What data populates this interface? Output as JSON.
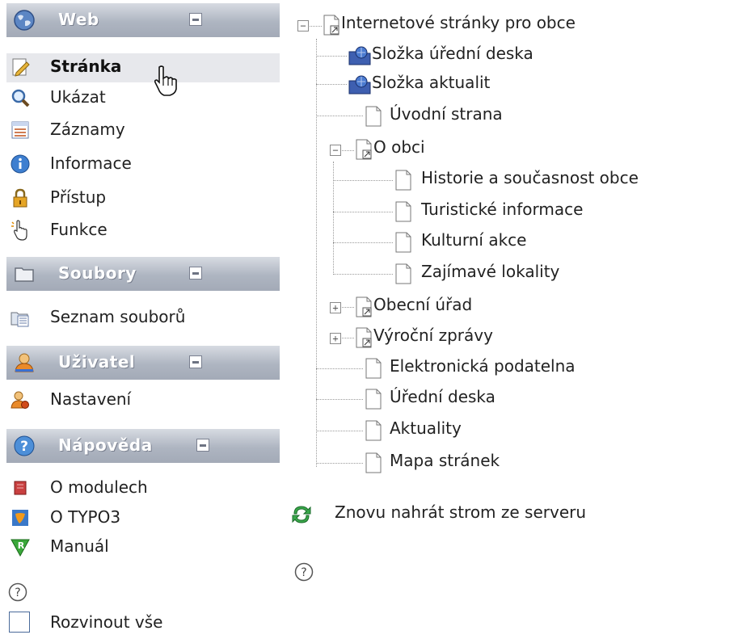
{
  "menu": {
    "groups": [
      {
        "title": "Web",
        "icon": "globe-icon",
        "items": [
          {
            "label": "Stránka",
            "icon": "page-edit-icon",
            "selected": true
          },
          {
            "label": "Ukázat",
            "icon": "magnifier-icon"
          },
          {
            "label": "Záznamy",
            "icon": "list-table-icon"
          },
          {
            "label": "Informace",
            "icon": "info-icon"
          },
          {
            "label": "Přístup",
            "icon": "padlock-icon"
          },
          {
            "label": "Funkce",
            "icon": "hand-pointer-icon"
          }
        ]
      },
      {
        "title": "Soubory",
        "icon": "folder-icon",
        "items": [
          {
            "label": "Seznam souborů",
            "icon": "file-list-icon"
          }
        ]
      },
      {
        "title": "Uživatel",
        "icon": "user-icon",
        "items": [
          {
            "label": "Nastavení",
            "icon": "user-settings-icon"
          }
        ]
      },
      {
        "title": "Nápověda",
        "icon": "help-icon",
        "items": [
          {
            "label": "O modulech",
            "icon": "module-icon"
          },
          {
            "label": "O TYPO3",
            "icon": "typo3-icon"
          },
          {
            "label": "Manuál",
            "icon": "manual-icon"
          }
        ]
      }
    ],
    "help_icon": "question-circle-icon",
    "expand_all_label": "Rozvinout vše"
  },
  "tree": {
    "nodes": [
      {
        "label": "Internetové stránky pro obce",
        "icon": "page-shortcut-icon",
        "level": 0,
        "toggle": "minus"
      },
      {
        "label": "Složka úřední deska",
        "icon": "sysfolder-icon",
        "level": 1
      },
      {
        "label": "Složka aktualit",
        "icon": "sysfolder-icon",
        "level": 1
      },
      {
        "label": "Úvodní strana",
        "icon": "page-icon",
        "level": 1
      },
      {
        "label": "O obci",
        "icon": "page-shortcut-icon",
        "level": 1,
        "toggle": "minus"
      },
      {
        "label": "Historie a současnost obce",
        "icon": "page-icon",
        "level": 2
      },
      {
        "label": "Turistické informace",
        "icon": "page-icon",
        "level": 2
      },
      {
        "label": "Kulturní akce",
        "icon": "page-icon",
        "level": 2
      },
      {
        "label": "Zajímavé lokality",
        "icon": "page-icon",
        "level": 2
      },
      {
        "label": "Obecní úřad",
        "icon": "page-shortcut-icon",
        "level": 1,
        "toggle": "plus"
      },
      {
        "label": "Výroční zprávy",
        "icon": "page-shortcut-icon",
        "level": 1,
        "toggle": "plus"
      },
      {
        "label": "Elektronická podatelna",
        "icon": "page-icon",
        "level": 1
      },
      {
        "label": "Úřední deska",
        "icon": "page-icon",
        "level": 1
      },
      {
        "label": "Aktuality",
        "icon": "page-icon",
        "level": 1
      },
      {
        "label": "Mapa stránek",
        "icon": "page-icon",
        "level": 1
      }
    ],
    "reload_label": "Znovu nahrát strom ze serveru",
    "reload_icon": "refresh-icon",
    "help_icon": "question-circle-icon"
  },
  "colors": {
    "group_header_bg": "#a9b0bc",
    "group_title": "#ffffff",
    "selected_item_bg": "#e7e8ec"
  }
}
